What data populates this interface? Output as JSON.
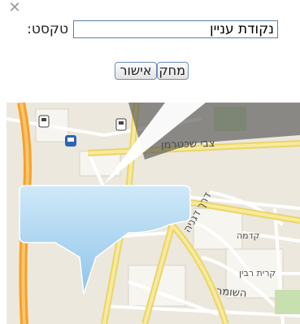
{
  "dialog": {
    "close_icon": "close-icon",
    "text_label": "טקסט:",
    "text_value": "נקודת עניין",
    "approve_label": "אישור",
    "delete_label": "מחק"
  },
  "map": {
    "street_labels": {
      "tzvi_shechterman": "צבי שכטרמן",
      "derech_dagania": "דרך דגניה",
      "kadima": "קדמה",
      "kiryat_rabin": "קרית רבין",
      "hashomer": "השומר"
    },
    "icons": [
      "fuel-station-icon",
      "fuel-station-icon",
      "bus-icon"
    ],
    "colors": {
      "highway": "#f7a12a",
      "major_road": "#f3e27a",
      "callout_fill": "#9fd0ef"
    }
  }
}
